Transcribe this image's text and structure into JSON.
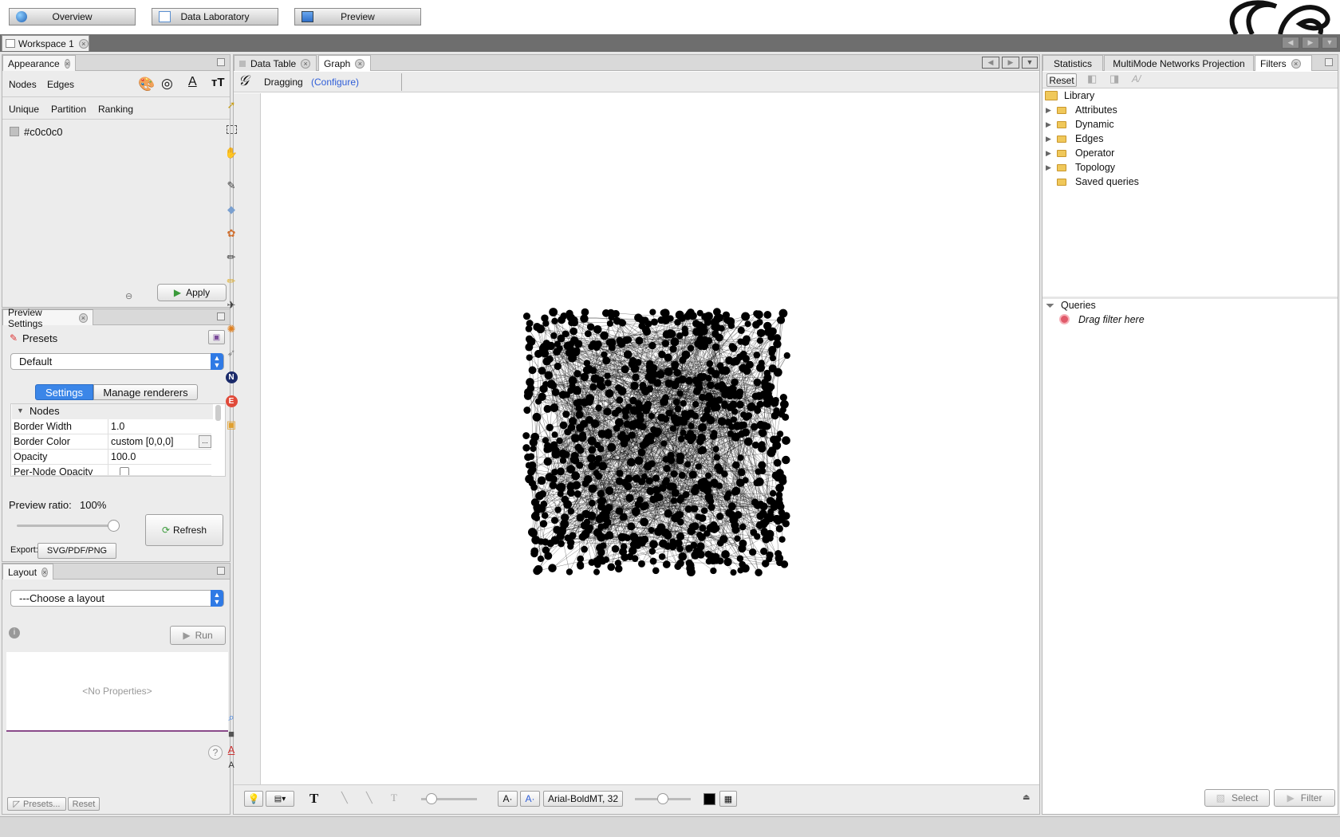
{
  "top_nav": {
    "overview": "Overview",
    "data_lab": "Data Laboratory",
    "preview": "Preview"
  },
  "workspace": {
    "tab": "Workspace 1"
  },
  "appearance": {
    "tab": "Appearance",
    "modes": [
      "Nodes",
      "Edges"
    ],
    "sub_tabs": [
      "Unique",
      "Partition",
      "Ranking"
    ],
    "color_value": "#c0c0c0",
    "apply": "Apply"
  },
  "preview_settings": {
    "tab": "Preview Settings",
    "presets_label": "Presets",
    "preset_selected": "Default",
    "tabs": [
      "Settings",
      "Manage renderers"
    ],
    "section": "Nodes",
    "properties": [
      {
        "key": "Border Width",
        "value": "1.0"
      },
      {
        "key": "Border Color",
        "value": "custom [0,0,0]"
      },
      {
        "key": "Opacity",
        "value": "100.0"
      },
      {
        "key": "Per-Node Opacity",
        "value": ""
      }
    ],
    "ratio_label": "Preview ratio:",
    "ratio_value": "100%",
    "ratio": 1.0,
    "refresh": "Refresh",
    "export_label": "Export:",
    "export_btn": "SVG/PDF/PNG"
  },
  "layout": {
    "tab": "Layout",
    "choose": "---Choose a layout",
    "run": "Run",
    "no_props": "<No Properties>",
    "presets": "Presets...",
    "reset": "Reset"
  },
  "center": {
    "tabs": [
      "Data Table",
      "Graph"
    ],
    "mode": "Dragging",
    "configure": "(Configure)",
    "font_label": "Arial-BoldMT, 32"
  },
  "right": {
    "tabs": [
      "Statistics",
      "MultiMode Networks Projection",
      "Filters"
    ],
    "reset": "Reset",
    "library": "Library",
    "items": [
      "Attributes",
      "Dynamic",
      "Edges",
      "Operator",
      "Topology",
      "Saved queries"
    ],
    "queries": "Queries",
    "drag_hint": "Drag filter here",
    "select": "Select",
    "filter": "Filter"
  },
  "colors": {
    "accent": "#2f7ae5",
    "node_fill": "#000000",
    "swatch": "#c0c0c0"
  }
}
